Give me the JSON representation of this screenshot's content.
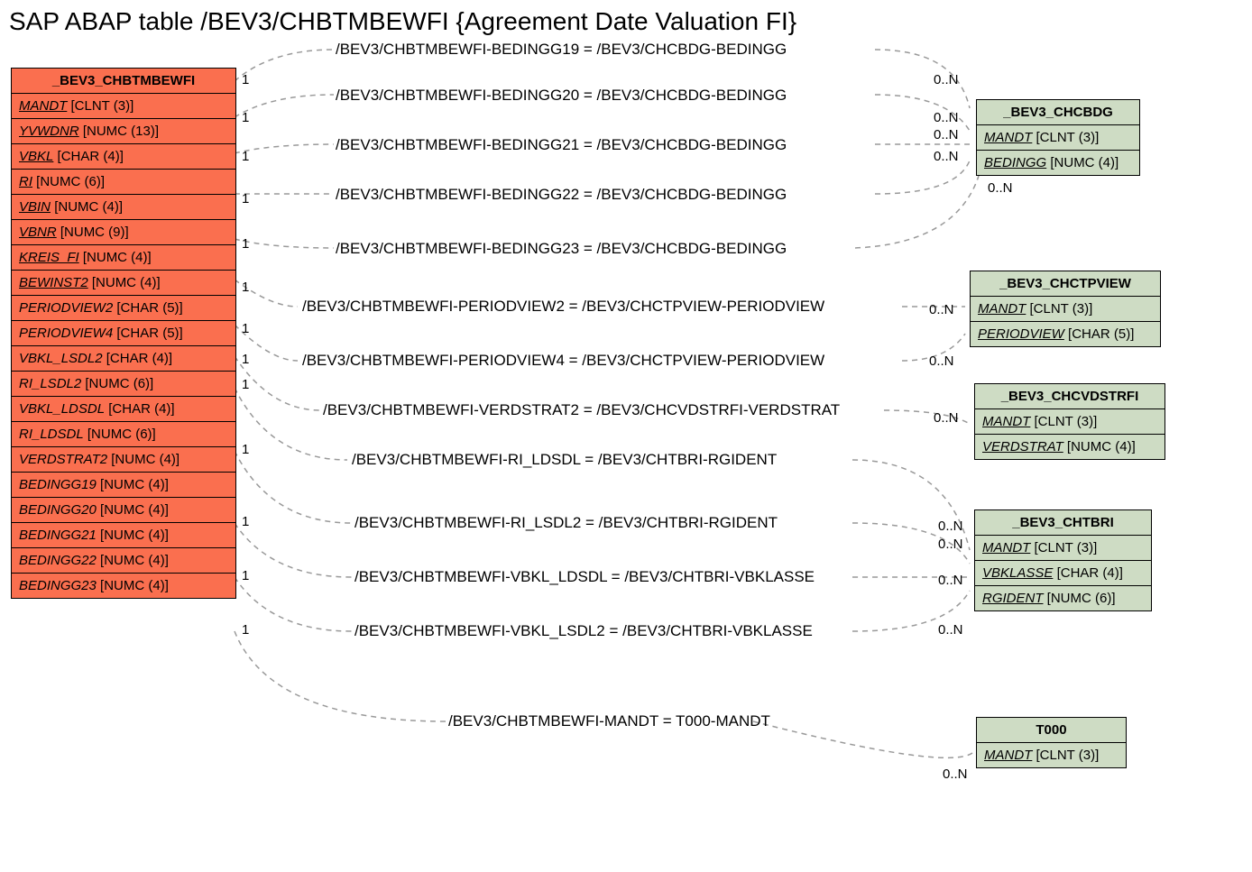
{
  "title": "SAP ABAP table /BEV3/CHBTMBEWFI {Agreement Date Valuation FI}",
  "main": {
    "name": "_BEV3_CHBTMBEWFI",
    "fields": [
      {
        "label": "MANDT",
        "type": "[CLNT (3)]",
        "style": "underline"
      },
      {
        "label": "YVWDNR",
        "type": "[NUMC (13)]",
        "style": "underline"
      },
      {
        "label": "VBKL",
        "type": "[CHAR (4)]",
        "style": "underline"
      },
      {
        "label": "RI",
        "type": "[NUMC (6)]",
        "style": "underline"
      },
      {
        "label": "VBIN",
        "type": "[NUMC (4)]",
        "style": "underline"
      },
      {
        "label": "VBNR",
        "type": "[NUMC (9)]",
        "style": "underline"
      },
      {
        "label": "KREIS_FI",
        "type": "[NUMC (4)]",
        "style": "underline"
      },
      {
        "label": "BEWINST2",
        "type": "[NUMC (4)]",
        "style": "underline"
      },
      {
        "label": "PERIODVIEW2",
        "type": "[CHAR (5)]",
        "style": "italic"
      },
      {
        "label": "PERIODVIEW4",
        "type": "[CHAR (5)]",
        "style": "italic"
      },
      {
        "label": "VBKL_LSDL2",
        "type": "[CHAR (4)]",
        "style": "italic"
      },
      {
        "label": "RI_LSDL2",
        "type": "[NUMC (6)]",
        "style": "italic"
      },
      {
        "label": "VBKL_LDSDL",
        "type": "[CHAR (4)]",
        "style": "italic"
      },
      {
        "label": "RI_LDSDL",
        "type": "[NUMC (6)]",
        "style": "italic"
      },
      {
        "label": "VERDSTRAT2",
        "type": "[NUMC (4)]",
        "style": "italic"
      },
      {
        "label": "BEDINGG19",
        "type": "[NUMC (4)]",
        "style": "italic"
      },
      {
        "label": "BEDINGG20",
        "type": "[NUMC (4)]",
        "style": "italic"
      },
      {
        "label": "BEDINGG21",
        "type": "[NUMC (4)]",
        "style": "italic"
      },
      {
        "label": "BEDINGG22",
        "type": "[NUMC (4)]",
        "style": "italic"
      },
      {
        "label": "BEDINGG23",
        "type": "[NUMC (4)]",
        "style": "italic"
      }
    ]
  },
  "tables": {
    "chcbdg": {
      "name": "_BEV3_CHCBDG",
      "fields": [
        {
          "label": "MANDT",
          "type": "[CLNT (3)]",
          "style": "underline"
        },
        {
          "label": "BEDINGG",
          "type": "[NUMC (4)]",
          "style": "underline"
        }
      ]
    },
    "chctpview": {
      "name": "_BEV3_CHCTPVIEW",
      "fields": [
        {
          "label": "MANDT",
          "type": "[CLNT (3)]",
          "style": "underline"
        },
        {
          "label": "PERIODVIEW",
          "type": "[CHAR (5)]",
          "style": "underline"
        }
      ]
    },
    "chcvdstrfi": {
      "name": "_BEV3_CHCVDSTRFI",
      "fields": [
        {
          "label": "MANDT",
          "type": "[CLNT (3)]",
          "style": "underline"
        },
        {
          "label": "VERDSTRAT",
          "type": "[NUMC (4)]",
          "style": "underline"
        }
      ]
    },
    "chtbri": {
      "name": "_BEV3_CHTBRI",
      "fields": [
        {
          "label": "MANDT",
          "type": "[CLNT (3)]",
          "style": "underline"
        },
        {
          "label": "VBKLASSE",
          "type": "[CHAR (4)]",
          "style": "underline"
        },
        {
          "label": "RGIDENT",
          "type": "[NUMC (6)]",
          "style": "underline"
        }
      ]
    },
    "t000": {
      "name": "T000",
      "fields": [
        {
          "label": "MANDT",
          "type": "[CLNT (3)]",
          "style": "underline"
        }
      ]
    }
  },
  "relations": [
    {
      "text": "/BEV3/CHBTMBEWFI-BEDINGG19 = /BEV3/CHCBDG-BEDINGG"
    },
    {
      "text": "/BEV3/CHBTMBEWFI-BEDINGG20 = /BEV3/CHCBDG-BEDINGG"
    },
    {
      "text": "/BEV3/CHBTMBEWFI-BEDINGG21 = /BEV3/CHCBDG-BEDINGG"
    },
    {
      "text": "/BEV3/CHBTMBEWFI-BEDINGG22 = /BEV3/CHCBDG-BEDINGG"
    },
    {
      "text": "/BEV3/CHBTMBEWFI-BEDINGG23 = /BEV3/CHCBDG-BEDINGG"
    },
    {
      "text": "/BEV3/CHBTMBEWFI-PERIODVIEW2 = /BEV3/CHCTPVIEW-PERIODVIEW"
    },
    {
      "text": "/BEV3/CHBTMBEWFI-PERIODVIEW4 = /BEV3/CHCTPVIEW-PERIODVIEW"
    },
    {
      "text": "/BEV3/CHBTMBEWFI-VERDSTRAT2 = /BEV3/CHCVDSTRFI-VERDSTRAT"
    },
    {
      "text": "/BEV3/CHBTMBEWFI-RI_LDSDL = /BEV3/CHTBRI-RGIDENT"
    },
    {
      "text": "/BEV3/CHBTMBEWFI-RI_LSDL2 = /BEV3/CHTBRI-RGIDENT"
    },
    {
      "text": "/BEV3/CHBTMBEWFI-VBKL_LDSDL = /BEV3/CHTBRI-VBKLASSE"
    },
    {
      "text": "/BEV3/CHBTMBEWFI-VBKL_LSDL2 = /BEV3/CHTBRI-VBKLASSE"
    },
    {
      "text": "/BEV3/CHBTMBEWFI-MANDT = T000-MANDT"
    }
  ],
  "card1": "1",
  "cardN": "0..N"
}
